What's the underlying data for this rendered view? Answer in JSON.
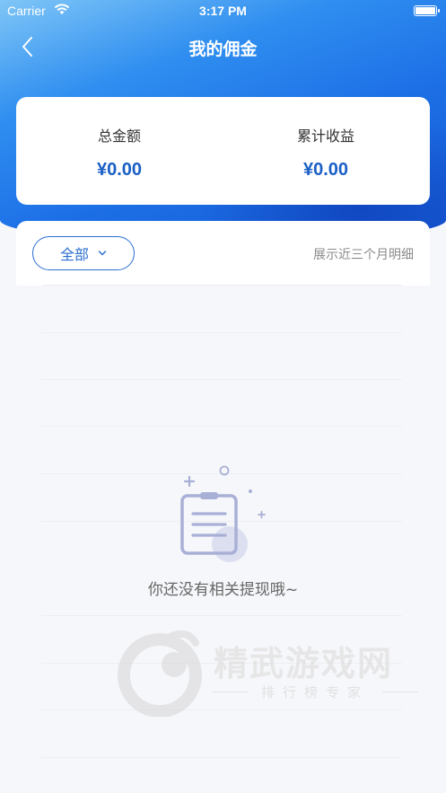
{
  "status_bar": {
    "carrier": "Carrier",
    "time": "3:17 PM"
  },
  "nav": {
    "title": "我的佣金",
    "back_icon": "chevron-left-icon"
  },
  "summary": {
    "total_label": "总金额",
    "total_value": "¥0.00",
    "cumulative_label": "累计收益",
    "cumulative_value": "¥0.00"
  },
  "filter": {
    "selected": "全部",
    "note": "展示近三个月明细"
  },
  "empty_state": {
    "icon": "clipboard-icon",
    "message": "你还没有相关提现哦~"
  },
  "watermark": {
    "title": "精武游戏网",
    "subtitle": "排行榜专家"
  },
  "colors": {
    "accent": "#1a5fc6",
    "header_gradient_start": "#7fc6f7",
    "header_gradient_end": "#1559d4",
    "background": "#f6f7fa"
  }
}
